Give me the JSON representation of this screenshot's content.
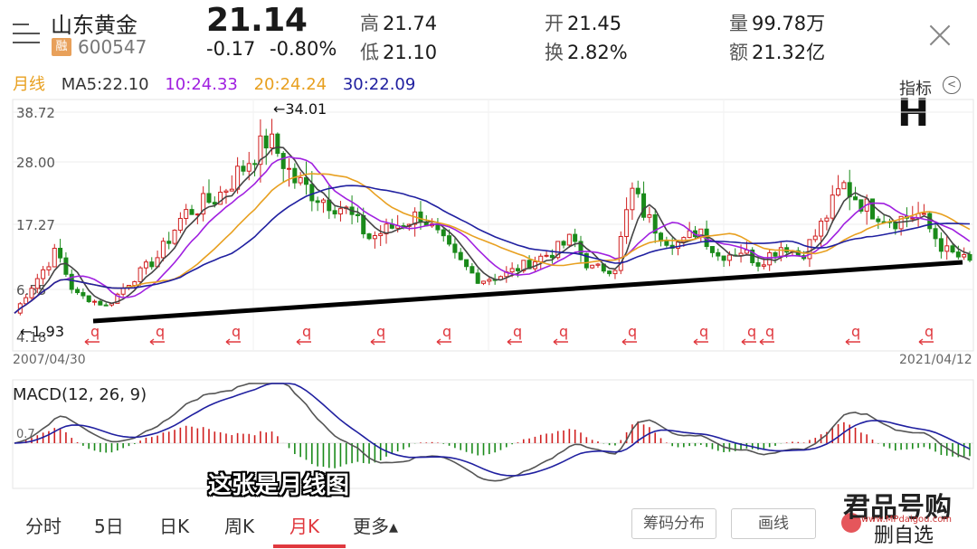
{
  "header": {
    "stock_name": "山东黄金",
    "badge": "融",
    "stock_code": "600547",
    "price": "21.14",
    "change": "-0.17",
    "change_pct": "-0.80%",
    "high_label": "高",
    "high": "21.74",
    "low_label": "低",
    "low": "21.10",
    "open_label": "开",
    "open": "21.45",
    "turnover_label": "换",
    "turnover": "2.82%",
    "volume_label": "量",
    "volume": "99.78万",
    "amount_label": "额",
    "amount": "21.32亿"
  },
  "ma_row": {
    "period": "月线",
    "ma5": "MA5:22.10",
    "ma10": "10:24.33",
    "ma20": "20:24.24",
    "ma30": "30:22.09",
    "indicator": "指标",
    "colors": {
      "period": "#e8a020",
      "ma5": "#333333",
      "ma10": "#a020e0",
      "ma20": "#e8a020",
      "ma30": "#2020a0"
    }
  },
  "annotation_letter": "H",
  "chart_data": {
    "type": "candlestick",
    "y_ticks": [
      "38.72",
      "28.00",
      "17.27",
      "6.55",
      "4.18"
    ],
    "high_marker": "←34.01",
    "low_marker": "←1.93",
    "start_date": "2007/04/30",
    "end_date": "2021/04/12",
    "q_markers": [
      "q",
      "q",
      "q",
      "q",
      "q",
      "q",
      "q",
      "q",
      "q",
      "q",
      "q",
      "q",
      "q",
      "q",
      "q",
      "q"
    ],
    "macd_label": "MACD(12, 26, 9)",
    "macd_tick": "0.7",
    "colors": {
      "up": "#d02020",
      "down": "#1a8a1a",
      "ma5": "#444444",
      "ma10": "#a020e0",
      "ma20": "#e8a020",
      "ma30": "#2020a0",
      "dif": "#555555",
      "dea": "#2020a0"
    }
  },
  "subtitle": "这张是月线图",
  "tabs": [
    {
      "label": "分时"
    },
    {
      "label": "5日"
    },
    {
      "label": "日K"
    },
    {
      "label": "周K"
    },
    {
      "label": "月K"
    },
    {
      "label": "更多▴"
    }
  ],
  "buttons": {
    "chip": "筹码分布",
    "draw": "画线"
  },
  "watermark": {
    "title": "君品号购",
    "url": "www.MPdaigou.com",
    "sub": "删自选"
  }
}
